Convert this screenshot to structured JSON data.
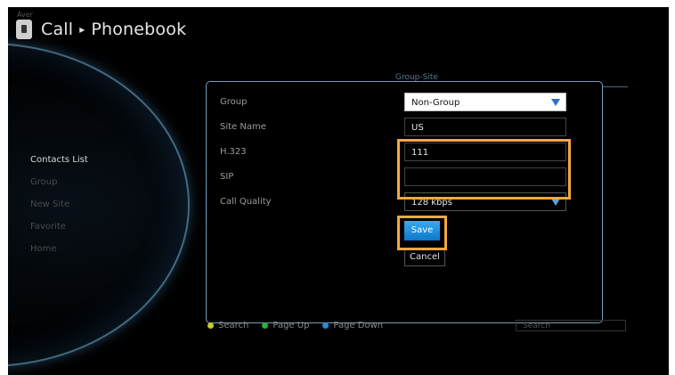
{
  "brand": "Aver",
  "header": {
    "section": "Call",
    "separator": "▸",
    "page": "Phonebook"
  },
  "menu": {
    "items": [
      {
        "label": "Contacts List",
        "active": true
      },
      {
        "label": "Group",
        "active": false
      },
      {
        "label": "New Site",
        "active": false
      },
      {
        "label": "Favorite",
        "active": false
      },
      {
        "label": "Home",
        "active": false
      }
    ]
  },
  "tab": {
    "label": "Group-Site"
  },
  "form": {
    "group": {
      "label": "Group",
      "value": "Non-Group"
    },
    "site_name": {
      "label": "Site Name",
      "value": "US"
    },
    "h323": {
      "label": "H.323",
      "value": "111"
    },
    "sip": {
      "label": "SIP",
      "value": ""
    },
    "call_quality": {
      "label": "Call Quality",
      "value": "128 kbps"
    },
    "save_label": "Save",
    "cancel_label": "Cancel"
  },
  "legend": {
    "items": [
      {
        "label": "Search",
        "color": "#c9c92c"
      },
      {
        "label": "Page Up",
        "color": "#2fae3d"
      },
      {
        "label": "Page Down",
        "color": "#2a8ad6"
      }
    ]
  },
  "search": {
    "placeholder": "Search"
  },
  "colors": {
    "highlight": "#f2a93b",
    "dialog_border": "#6fa0bd",
    "accent": "#1e8fdc"
  }
}
